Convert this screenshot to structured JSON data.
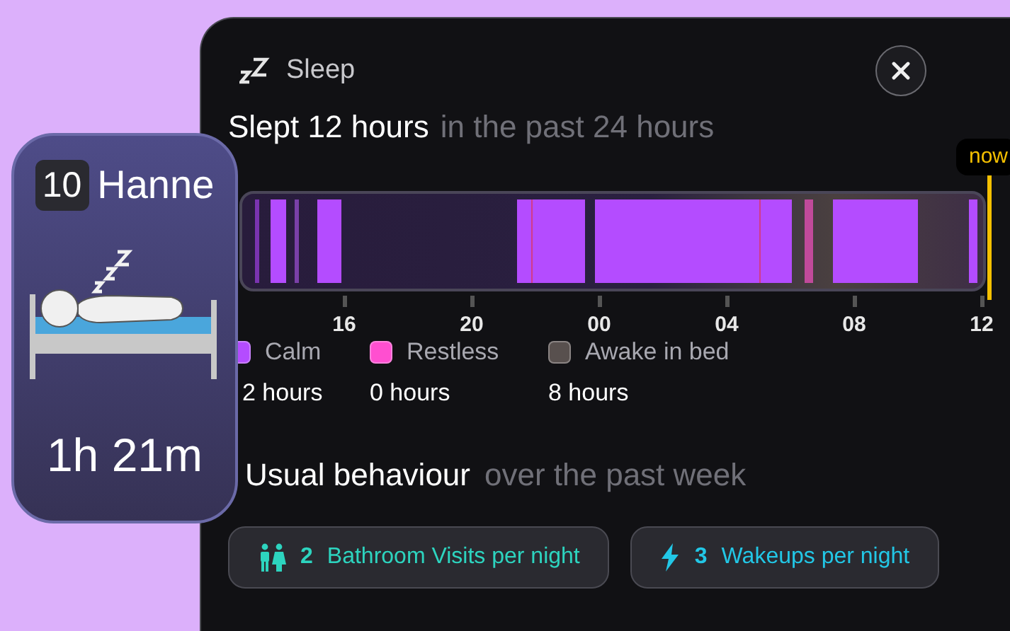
{
  "person": {
    "room": "10",
    "name": "Hanne",
    "duration": "1h 21m"
  },
  "panel": {
    "title": "Sleep"
  },
  "heading": {
    "main": "Slept 12 hours",
    "sub": "in the past 24 hours"
  },
  "timeline": {
    "now_label": "now",
    "ticks": [
      "16",
      "20",
      "00",
      "04",
      "08",
      "12"
    ]
  },
  "legend": [
    {
      "label": "Calm",
      "value": "2 hours",
      "color": "#b44cff"
    },
    {
      "label": "Restless",
      "value": "0 hours",
      "color": "#ff4fd0"
    },
    {
      "label": "Awake in bed",
      "value": "8 hours",
      "color": "#58504e"
    }
  ],
  "usual": {
    "main": "Usual behaviour",
    "sub": "over the past week"
  },
  "stats": [
    {
      "kind": "bathroom",
      "count": "2",
      "label": "Bathroom Visits per night"
    },
    {
      "kind": "wakeups",
      "count": "3",
      "label": "Wakeups per night"
    }
  ]
}
